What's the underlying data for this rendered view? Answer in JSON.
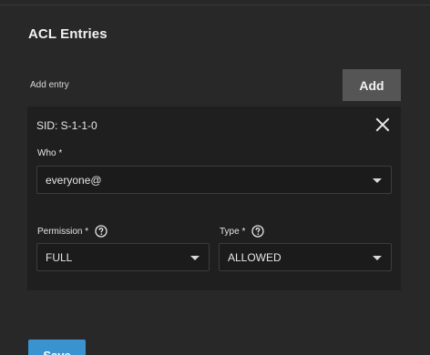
{
  "section": {
    "title": "ACL Entries",
    "add_entry_label": "Add entry",
    "add_button": "Add"
  },
  "entry": {
    "sid": "SID: S-1-1-0",
    "who": {
      "label": "Who *",
      "value": "everyone@"
    },
    "permission": {
      "label": "Permission *",
      "value": "FULL"
    },
    "type": {
      "label": "Type *",
      "value": "ALLOWED"
    }
  },
  "footer": {
    "save_button": "Save"
  },
  "icons": {
    "close": "close-icon",
    "help": "help-circle-icon",
    "dropdown": "chevron-down-icon"
  },
  "colors": {
    "primary": "#3a93cf",
    "card_bg": "#1f1f1f",
    "page_bg": "#282828",
    "add_button_bg": "#555555"
  }
}
